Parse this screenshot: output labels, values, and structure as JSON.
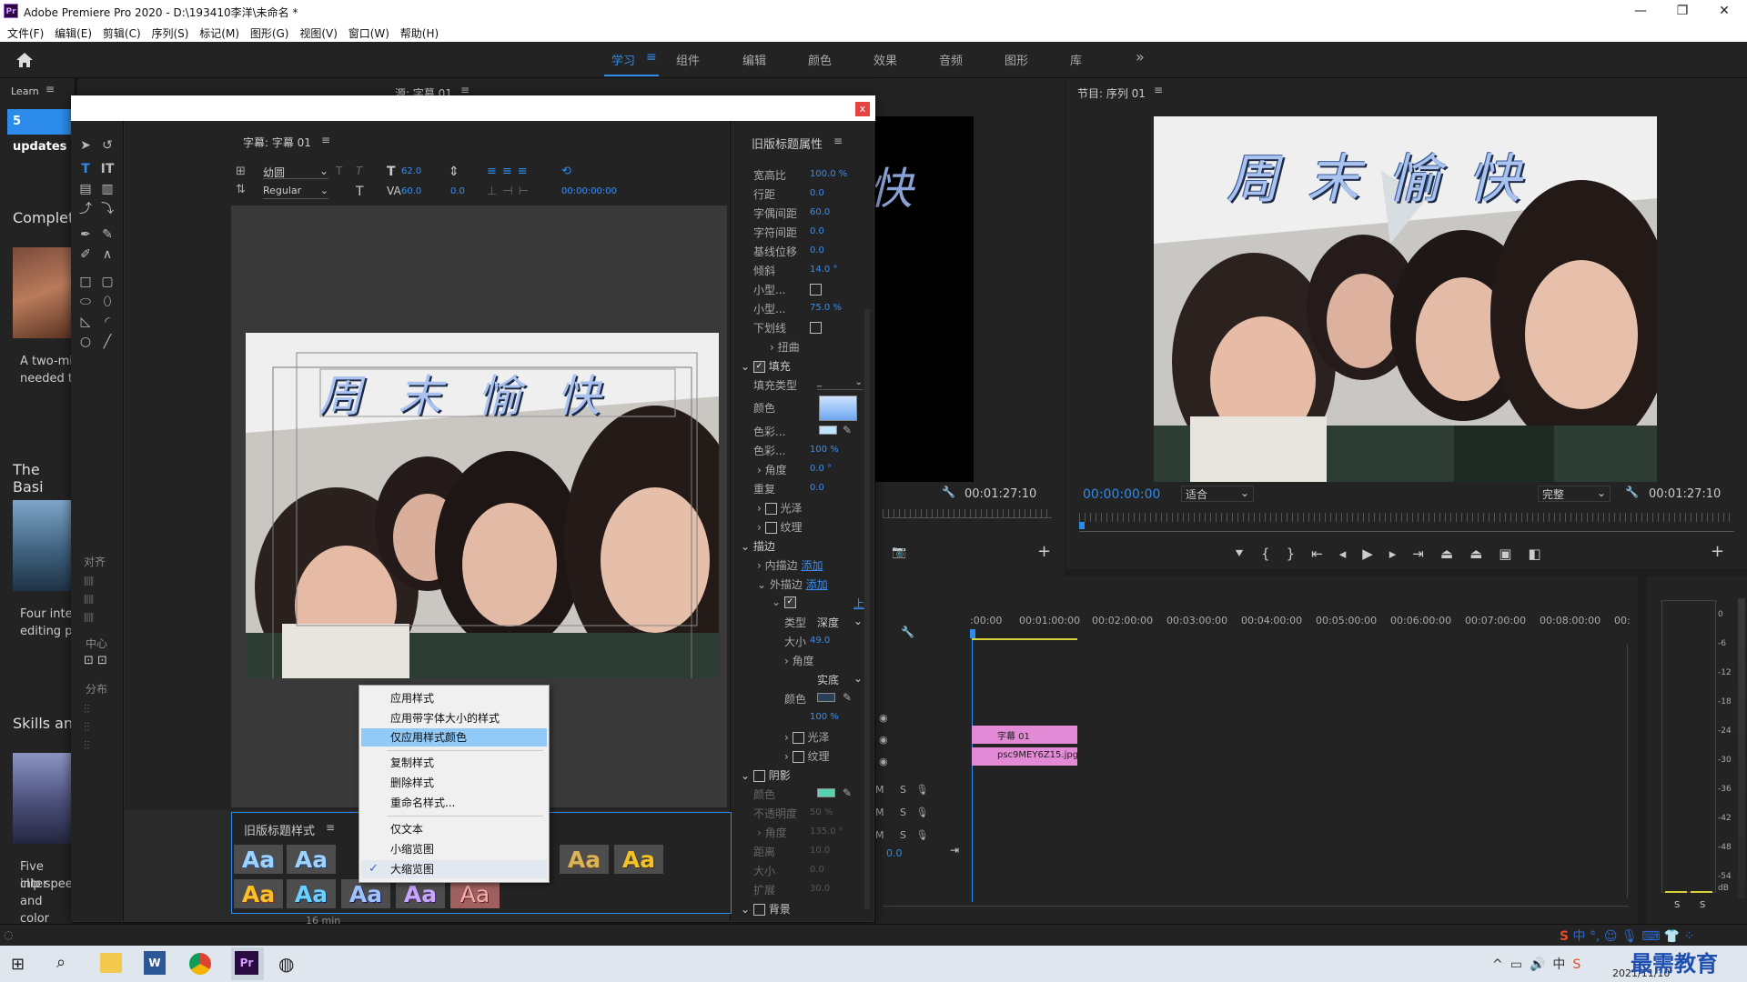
{
  "app": {
    "title": "Adobe Premiere Pro 2020 - D:\\193410李洋\\未命名 *",
    "logo": "Pr",
    "menu": [
      "文件(F)",
      "编辑(E)",
      "剪辑(C)",
      "序列(S)",
      "标记(M)",
      "图形(G)",
      "视图(V)",
      "窗口(W)",
      "帮助(H)"
    ]
  },
  "workspaces": {
    "tabs": [
      "学习",
      "组件",
      "编辑",
      "颜色",
      "效果",
      "音频",
      "图形",
      "库"
    ],
    "active": "学习",
    "more": "»"
  },
  "learn": {
    "header": "Learn",
    "updates": "5 updates",
    "sections": [
      {
        "heading": "Complet",
        "desc1": "A two-mi",
        "desc2": "needed t"
      },
      {
        "heading": "The Basi",
        "desc1": "Four inte",
        "desc2": "editing p"
      },
      {
        "heading": "Skills an",
        "desc1": "Five inter",
        "desc2": "clip spee",
        "desc3": "and color"
      }
    ],
    "footer": "16 min"
  },
  "source": {
    "header": "源: 字幕 01",
    "preview_char": "快",
    "timecode": "00:01:27:10"
  },
  "program": {
    "header": "节目: 序列 01",
    "title_text": "周 末 愉 快",
    "timecode_current": "00:00:00:00",
    "fit": "适合",
    "quality": "完整",
    "timecode_end": "00:01:27:10"
  },
  "title_dialog": {
    "close": "x",
    "panel_header": "字幕: 字幕 01",
    "font": "幼圆",
    "style": "Regular",
    "font_size": "62.0",
    "kerning_size": "60.0",
    "leading": "0.0",
    "timecode": "00:00:00:00",
    "title_text": "周 末 愉 快",
    "align_label": "对齐",
    "center_label": "中心",
    "distribute_label": "分布"
  },
  "properties": {
    "header": "旧版标题属性",
    "rows": [
      {
        "label": "宽高比",
        "value": "100.0 %"
      },
      {
        "label": "行距",
        "value": "0.0"
      },
      {
        "label": "字偶间距",
        "value": "60.0"
      },
      {
        "label": "字符间距",
        "value": "0.0"
      },
      {
        "label": "基线位移",
        "value": "0.0"
      },
      {
        "label": "倾斜",
        "value": "14.0 °"
      },
      {
        "label": "小型...",
        "value": ""
      },
      {
        "label": "小型...",
        "value": "75.0 %"
      },
      {
        "label": "下划线",
        "value": ""
      }
    ],
    "distort": "扭曲",
    "fill": "填充",
    "fill_type_label": "填充类型",
    "fill_type_value": "_",
    "color_label": "颜色",
    "color_stop_label": "色彩...",
    "color_stop2_label": "色彩...",
    "color_stop2_value": "100 %",
    "angle_label": "角度",
    "angle_value": "0.0 °",
    "repeat_label": "重复",
    "repeat_value": "0.0",
    "sheen": "光泽",
    "texture": "纹理",
    "stroke": "描边",
    "inner_stroke": "内描边",
    "outer_stroke": "外描边",
    "add": "添加",
    "up": "上",
    "type_label": "类型",
    "type_value": "深度",
    "size_label": "大小",
    "size_value": "49.0",
    "angle2_label": "角度",
    "fill2_value": "实底",
    "color2_label": "颜色",
    "opacity_value": "100 %",
    "sheen2": "光泽",
    "texture2": "纹理",
    "shadow": "阴影",
    "shadow_color": "颜色",
    "shadow_opacity_label": "不透明度",
    "shadow_opacity_value": "50 %",
    "shadow_angle_label": "角度",
    "shadow_angle_value": "135.0 °",
    "shadow_distance_label": "距离",
    "shadow_distance_value": "10.0",
    "shadow_size_label": "大小",
    "shadow_size_value": "0.0",
    "shadow_spread_label": "扩展",
    "shadow_spread_value": "30.0",
    "background": "背景",
    "colors": {
      "fill": "#8fbdf5",
      "stroke_swatch": "#2b3f5a",
      "shadow_swatch": "#5ad1b0"
    }
  },
  "styles": {
    "header": "旧版标题样式",
    "swatch_text": "Aa"
  },
  "context_menu": {
    "items": [
      "应用样式",
      "应用带字体大小的样式",
      "仅应用样式颜色",
      "复制样式",
      "删除样式",
      "重命名样式...",
      "仅文本",
      "小缩览图",
      "大缩览图"
    ],
    "highlighted": "仅应用样式颜色",
    "checked": "大缩览图"
  },
  "timeline": {
    "ruler": [
      ":00:00",
      "00:01:00:00",
      "00:02:00:00",
      "00:03:00:00",
      "00:04:00:00",
      "00:05:00:00",
      "00:06:00:00",
      "00:07:00:00",
      "00:08:00:00",
      "00:"
    ],
    "clip1": "字幕 01",
    "clip2": "psc9MEY6Z15.jpg",
    "track_labels": [
      "M",
      "S"
    ],
    "offset": "0.0"
  },
  "meters": {
    "scale": [
      "0",
      "-6",
      "-12",
      "-18",
      "-24",
      "-30",
      "-36",
      "-42",
      "-48",
      "-54",
      "dB"
    ],
    "solo": "S"
  },
  "taskbar": {
    "date": "2021/11/10",
    "time": "",
    "ime": "中",
    "watermark": "最需教育"
  }
}
